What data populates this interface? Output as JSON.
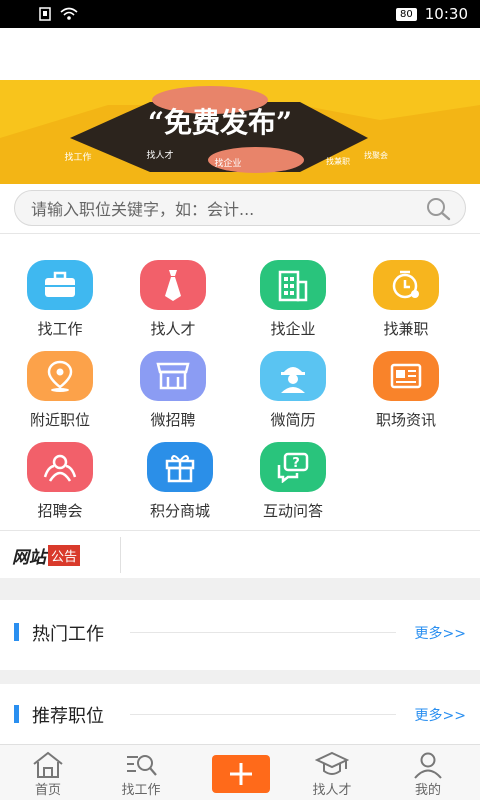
{
  "status_bar": {
    "battery": "80",
    "time": "10:30"
  },
  "banner": {
    "headline": "“免费发布”",
    "tags": [
      "找工作",
      "找人才",
      "找企业",
      "找兼职",
      "找聚会"
    ]
  },
  "search": {
    "placeholder": "请输入职位关键字，如：会计..."
  },
  "features": [
    {
      "label": "找工作",
      "icon": "briefcase-icon",
      "color": "#3fb8f0"
    },
    {
      "label": "找人才",
      "icon": "tie-icon",
      "color": "#f2606a"
    },
    {
      "label": "找企业",
      "icon": "building-icon",
      "color": "#29c47c"
    },
    {
      "label": "找兼职",
      "icon": "clock-icon",
      "color": "#f7b51e"
    },
    {
      "label": "附近职位",
      "icon": "location-icon",
      "color": "#fca24a"
    },
    {
      "label": "微招聘",
      "icon": "shop-icon",
      "color": "#8b9cf3"
    },
    {
      "label": "微简历",
      "icon": "worker-icon",
      "color": "#5ac4f2"
    },
    {
      "label": "职场资讯",
      "icon": "news-icon",
      "color": "#f9832a"
    },
    {
      "label": "招聘会",
      "icon": "crowd-icon",
      "color": "#f2606a"
    },
    {
      "label": "积分商城",
      "icon": "gift-icon",
      "color": "#2b8fe8"
    },
    {
      "label": "互动问答",
      "icon": "question-icon",
      "color": "#29c47c"
    }
  ],
  "notice": {
    "logo_text_a": "网站",
    "logo_text_b": "公告"
  },
  "sections": [
    {
      "title": "热门工作",
      "more": "更多>>"
    },
    {
      "title": "推荐职位",
      "more": "更多>>"
    }
  ],
  "tabbar": [
    {
      "label": "首页",
      "icon": "home-icon"
    },
    {
      "label": "找工作",
      "icon": "job-search-icon"
    },
    {
      "label": "",
      "icon": "plus-icon"
    },
    {
      "label": "找人才",
      "icon": "graduate-icon"
    },
    {
      "label": "我的",
      "icon": "user-icon"
    }
  ]
}
